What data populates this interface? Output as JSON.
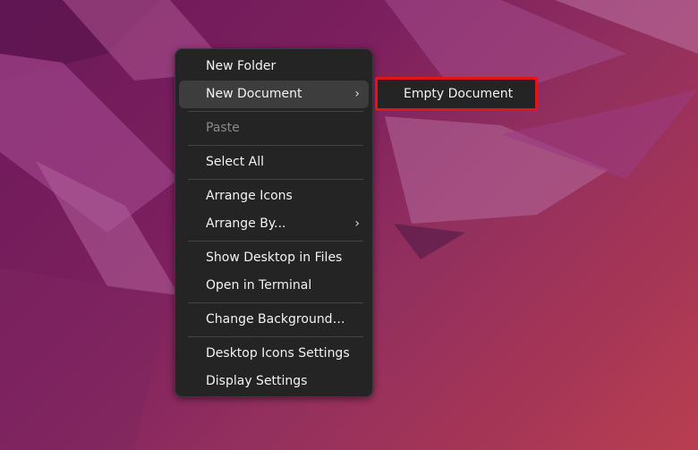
{
  "context_menu": {
    "groups": [
      [
        {
          "label": "New Folder",
          "state": "normal",
          "submenu": false
        },
        {
          "label": "New Document",
          "state": "hover",
          "submenu": true
        }
      ],
      [
        {
          "label": "Paste",
          "state": "disabled",
          "submenu": false
        }
      ],
      [
        {
          "label": "Select All",
          "state": "normal",
          "submenu": false
        }
      ],
      [
        {
          "label": "Arrange Icons",
          "state": "normal",
          "submenu": false
        },
        {
          "label": "Arrange By...",
          "state": "normal",
          "submenu": true
        }
      ],
      [
        {
          "label": "Show Desktop in Files",
          "state": "normal",
          "submenu": false
        },
        {
          "label": "Open in Terminal",
          "state": "normal",
          "submenu": false
        }
      ],
      [
        {
          "label": "Change Background…",
          "state": "normal",
          "submenu": false
        }
      ],
      [
        {
          "label": "Desktop Icons Settings",
          "state": "normal",
          "submenu": false
        },
        {
          "label": "Display Settings",
          "state": "normal",
          "submenu": false
        }
      ]
    ]
  },
  "submenu": {
    "items": [
      {
        "label": "Empty Document"
      }
    ],
    "highlight_color": "#e0141b"
  },
  "icons": {
    "submenu_arrow": "chevron-right-icon",
    "glyph": "›"
  }
}
